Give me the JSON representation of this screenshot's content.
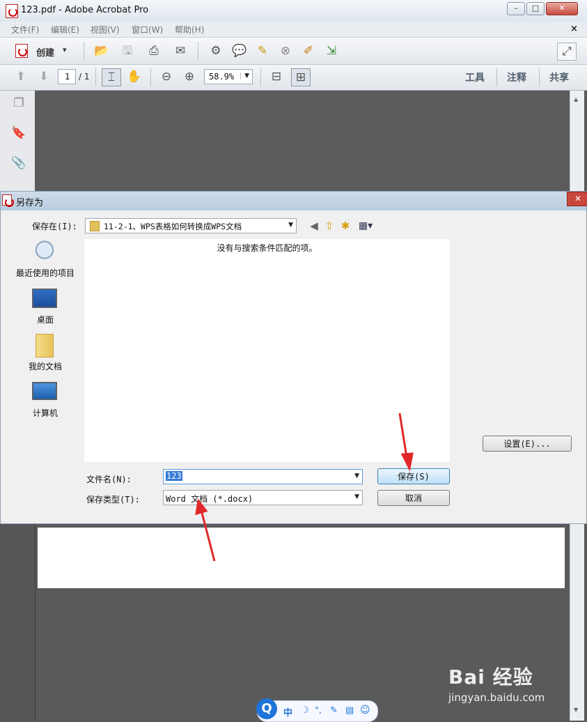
{
  "window": {
    "title": "123.pdf - Adobe Acrobat Pro",
    "min": "–",
    "max": "□",
    "close": "✕"
  },
  "menu": [
    "文件(F)",
    "编辑(E)",
    "视图(V)",
    "窗口(W)",
    "帮助(H)"
  ],
  "menu_close": "×",
  "toolbar": {
    "create_label": "创建",
    "create_arrow": "▾"
  },
  "nav": {
    "page_value": "1",
    "page_total": "/ 1",
    "zoom": "58.9%",
    "tools": "工具",
    "comment": "注释",
    "share": "共享"
  },
  "dialog": {
    "title": "另存为",
    "close": "✕",
    "save_in_label": "保存在(I):",
    "save_in_value": "11-2-1、WPS表格如何转换成WPS文档",
    "empty_message": "没有与搜索条件匹配的项。",
    "places": [
      "最近使用的项目",
      "桌面",
      "我的文档",
      "计算机"
    ],
    "filename_label": "文件名(N):",
    "filename_value": "123",
    "filetype_label": "保存类型(T):",
    "filetype_value": "Word 文档 (*.docx)",
    "save_button": "保存(S)",
    "cancel_button": "取消",
    "settings_button": "设置(E)..."
  },
  "ime": {
    "lang": "中",
    "items": [
      "☽",
      "°,",
      "✎",
      "▤",
      "☺"
    ]
  },
  "watermark": {
    "brand": "Bai 经验",
    "url": "jingyan.baidu.com"
  }
}
